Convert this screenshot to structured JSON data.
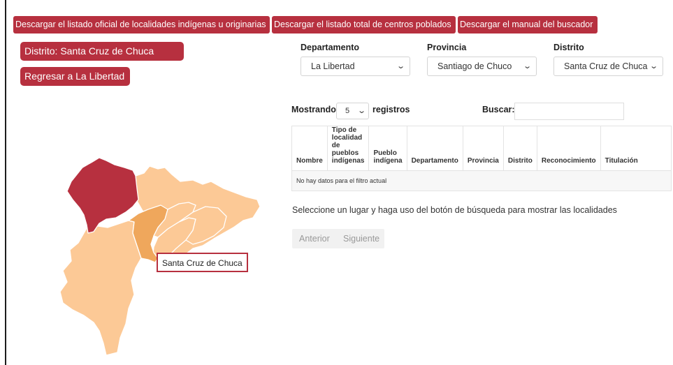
{
  "top_buttons": [
    "Descargar el listado oficial de localidades indígenas u originarias",
    "Descargar el listado total de centros poblados",
    "Descargar el manual del buscador"
  ],
  "district_badge": "Distrito: Santa Cruz de Chuca",
  "back_button": "Regresar a La Libertad",
  "filters": {
    "departamento": {
      "label": "Departamento",
      "value": "La Libertad"
    },
    "provincia": {
      "label": "Provincia",
      "value": "Santiago de Chuco"
    },
    "distrito": {
      "label": "Distrito",
      "value": "Santa Cruz de Chuca"
    }
  },
  "table_controls": {
    "showing_label": "Mostrando",
    "page_length": "5",
    "records_label": "registros",
    "search_label": "Buscar:",
    "search_value": ""
  },
  "table": {
    "headers": [
      "Nombre",
      "Tipo de localidad de pueblos indígenas",
      "Pueblo indígena",
      "Departamento",
      "Provincia",
      "Distrito",
      "Reconocimiento",
      "Titulación"
    ],
    "empty_message": "No hay datos para el filtro actual"
  },
  "info_text": "Seleccione un lugar y haga uso del botón de búsqueda para mostrar las localidades",
  "pagination": {
    "previous": "Anterior",
    "next": "Siguiente"
  },
  "map": {
    "tooltip": "Santa Cruz de Chuca",
    "colors": {
      "selected_district": "#b7303f",
      "hovered_district": "#efa75c",
      "other_districts": "#fcc996",
      "district_border": "#ffffff",
      "accent_button": "#b7303f"
    }
  }
}
